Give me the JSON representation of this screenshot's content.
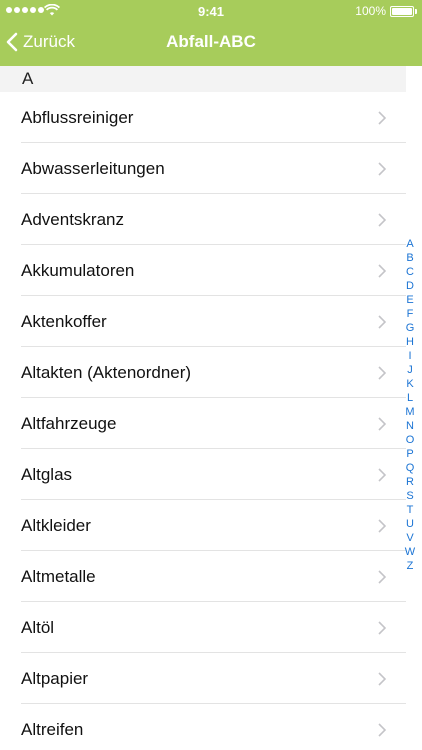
{
  "status_bar": {
    "time": "9:41",
    "battery": "100%"
  },
  "nav": {
    "back_label": "Zurück",
    "title": "Abfall-ABC"
  },
  "section": {
    "header": "A"
  },
  "items": [
    "Abflussreiniger",
    "Abwasserleitungen",
    "Adventskranz",
    "Akkumulatoren",
    "Aktenkoffer",
    "Altakten (Aktenordner)",
    "Altfahrzeuge",
    "Altglas",
    "Altkleider",
    "Altmetalle",
    "Altöl",
    "Altpapier",
    "Altreifen"
  ],
  "index": [
    "A",
    "B",
    "C",
    "D",
    "E",
    "F",
    "G",
    "H",
    "I",
    "J",
    "K",
    "L",
    "M",
    "N",
    "O",
    "P",
    "Q",
    "R",
    "S",
    "T",
    "U",
    "V",
    "W",
    "Z"
  ],
  "colors": {
    "nav_bar": "#a7cc5b",
    "index_accent": "#1b74d4",
    "section_bg": "#f3f3f3"
  }
}
